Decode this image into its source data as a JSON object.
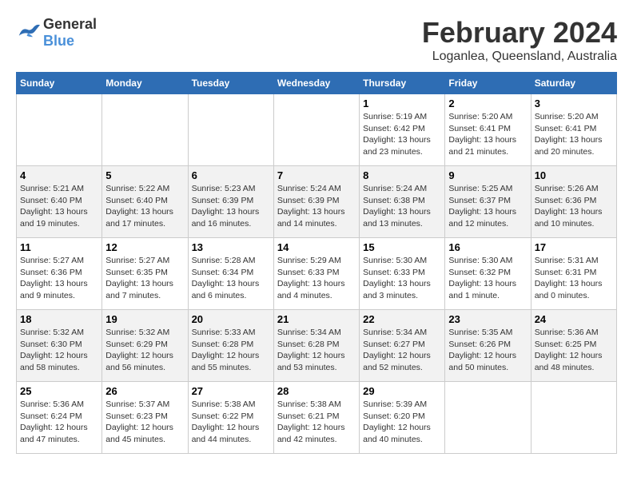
{
  "header": {
    "logo_general": "General",
    "logo_blue": "Blue",
    "month_year": "February 2024",
    "location": "Loganlea, Queensland, Australia"
  },
  "weekdays": [
    "Sunday",
    "Monday",
    "Tuesday",
    "Wednesday",
    "Thursday",
    "Friday",
    "Saturday"
  ],
  "weeks": [
    [
      {
        "day": "",
        "info": ""
      },
      {
        "day": "",
        "info": ""
      },
      {
        "day": "",
        "info": ""
      },
      {
        "day": "",
        "info": ""
      },
      {
        "day": "1",
        "info": "Sunrise: 5:19 AM\nSunset: 6:42 PM\nDaylight: 13 hours\nand 23 minutes."
      },
      {
        "day": "2",
        "info": "Sunrise: 5:20 AM\nSunset: 6:41 PM\nDaylight: 13 hours\nand 21 minutes."
      },
      {
        "day": "3",
        "info": "Sunrise: 5:20 AM\nSunset: 6:41 PM\nDaylight: 13 hours\nand 20 minutes."
      }
    ],
    [
      {
        "day": "4",
        "info": "Sunrise: 5:21 AM\nSunset: 6:40 PM\nDaylight: 13 hours\nand 19 minutes."
      },
      {
        "day": "5",
        "info": "Sunrise: 5:22 AM\nSunset: 6:40 PM\nDaylight: 13 hours\nand 17 minutes."
      },
      {
        "day": "6",
        "info": "Sunrise: 5:23 AM\nSunset: 6:39 PM\nDaylight: 13 hours\nand 16 minutes."
      },
      {
        "day": "7",
        "info": "Sunrise: 5:24 AM\nSunset: 6:39 PM\nDaylight: 13 hours\nand 14 minutes."
      },
      {
        "day": "8",
        "info": "Sunrise: 5:24 AM\nSunset: 6:38 PM\nDaylight: 13 hours\nand 13 minutes."
      },
      {
        "day": "9",
        "info": "Sunrise: 5:25 AM\nSunset: 6:37 PM\nDaylight: 13 hours\nand 12 minutes."
      },
      {
        "day": "10",
        "info": "Sunrise: 5:26 AM\nSunset: 6:36 PM\nDaylight: 13 hours\nand 10 minutes."
      }
    ],
    [
      {
        "day": "11",
        "info": "Sunrise: 5:27 AM\nSunset: 6:36 PM\nDaylight: 13 hours\nand 9 minutes."
      },
      {
        "day": "12",
        "info": "Sunrise: 5:27 AM\nSunset: 6:35 PM\nDaylight: 13 hours\nand 7 minutes."
      },
      {
        "day": "13",
        "info": "Sunrise: 5:28 AM\nSunset: 6:34 PM\nDaylight: 13 hours\nand 6 minutes."
      },
      {
        "day": "14",
        "info": "Sunrise: 5:29 AM\nSunset: 6:33 PM\nDaylight: 13 hours\nand 4 minutes."
      },
      {
        "day": "15",
        "info": "Sunrise: 5:30 AM\nSunset: 6:33 PM\nDaylight: 13 hours\nand 3 minutes."
      },
      {
        "day": "16",
        "info": "Sunrise: 5:30 AM\nSunset: 6:32 PM\nDaylight: 13 hours\nand 1 minute."
      },
      {
        "day": "17",
        "info": "Sunrise: 5:31 AM\nSunset: 6:31 PM\nDaylight: 13 hours\nand 0 minutes."
      }
    ],
    [
      {
        "day": "18",
        "info": "Sunrise: 5:32 AM\nSunset: 6:30 PM\nDaylight: 12 hours\nand 58 minutes."
      },
      {
        "day": "19",
        "info": "Sunrise: 5:32 AM\nSunset: 6:29 PM\nDaylight: 12 hours\nand 56 minutes."
      },
      {
        "day": "20",
        "info": "Sunrise: 5:33 AM\nSunset: 6:28 PM\nDaylight: 12 hours\nand 55 minutes."
      },
      {
        "day": "21",
        "info": "Sunrise: 5:34 AM\nSunset: 6:28 PM\nDaylight: 12 hours\nand 53 minutes."
      },
      {
        "day": "22",
        "info": "Sunrise: 5:34 AM\nSunset: 6:27 PM\nDaylight: 12 hours\nand 52 minutes."
      },
      {
        "day": "23",
        "info": "Sunrise: 5:35 AM\nSunset: 6:26 PM\nDaylight: 12 hours\nand 50 minutes."
      },
      {
        "day": "24",
        "info": "Sunrise: 5:36 AM\nSunset: 6:25 PM\nDaylight: 12 hours\nand 48 minutes."
      }
    ],
    [
      {
        "day": "25",
        "info": "Sunrise: 5:36 AM\nSunset: 6:24 PM\nDaylight: 12 hours\nand 47 minutes."
      },
      {
        "day": "26",
        "info": "Sunrise: 5:37 AM\nSunset: 6:23 PM\nDaylight: 12 hours\nand 45 minutes."
      },
      {
        "day": "27",
        "info": "Sunrise: 5:38 AM\nSunset: 6:22 PM\nDaylight: 12 hours\nand 44 minutes."
      },
      {
        "day": "28",
        "info": "Sunrise: 5:38 AM\nSunset: 6:21 PM\nDaylight: 12 hours\nand 42 minutes."
      },
      {
        "day": "29",
        "info": "Sunrise: 5:39 AM\nSunset: 6:20 PM\nDaylight: 12 hours\nand 40 minutes."
      },
      {
        "day": "",
        "info": ""
      },
      {
        "day": "",
        "info": ""
      }
    ]
  ]
}
